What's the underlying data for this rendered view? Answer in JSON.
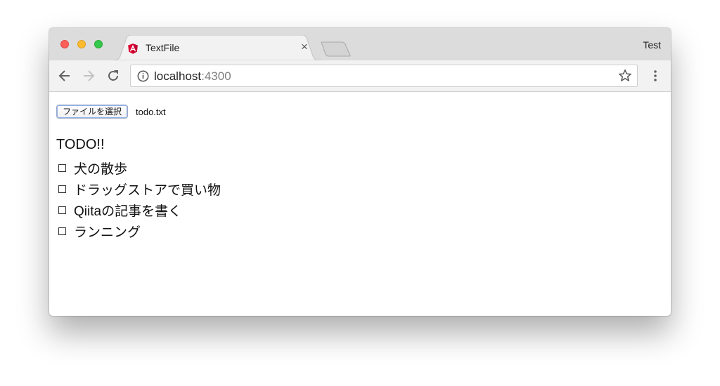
{
  "browser": {
    "tab": {
      "title": "TextFile",
      "close": "×"
    },
    "profile": "Test",
    "address": {
      "host": "localhost",
      "port": ":4300"
    }
  },
  "page": {
    "file_button": "ファイルを選択",
    "file_name": "todo.txt",
    "todo_title": "TODO!!",
    "items": [
      {
        "label": "犬の散歩"
      },
      {
        "label": "ドラッグストアで買い物"
      },
      {
        "label": "Qiitaの記事を書く"
      },
      {
        "label": "ランニング"
      }
    ]
  },
  "colors": {
    "titlebar": "#dcdcdc",
    "toolbar": "#f2f2f2",
    "angular_red": "#dd0031"
  }
}
